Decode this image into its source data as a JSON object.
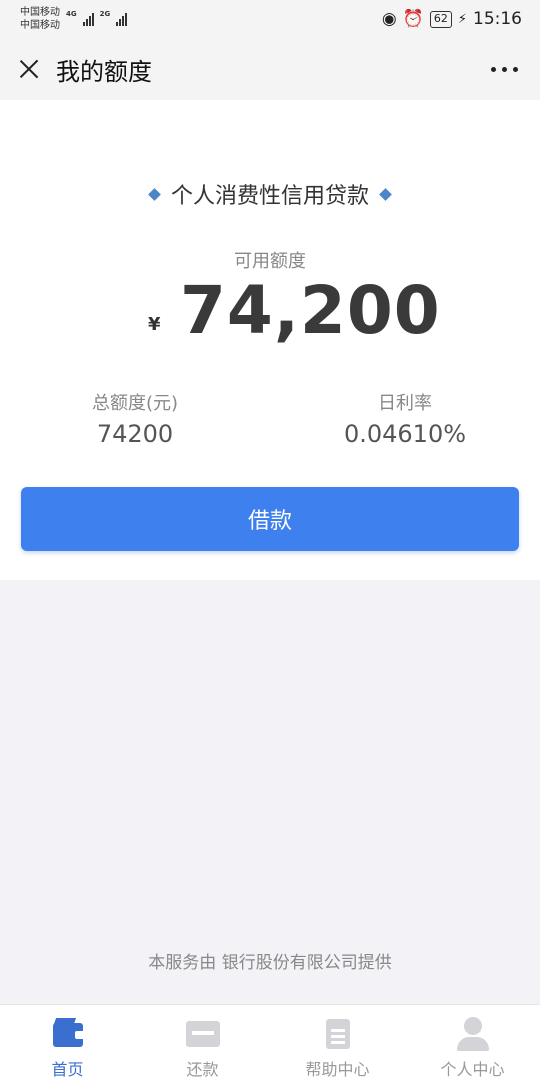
{
  "status_bar": {
    "carrier_1": "中国移动",
    "carrier_2": "中国移动",
    "network_1": "4G",
    "network_2": "2G",
    "battery": "62",
    "time": "15:16"
  },
  "nav": {
    "title": "我的额度"
  },
  "card": {
    "product_name": "个人消费性信用贷款",
    "available_label": "可用额度",
    "currency_symbol": "¥",
    "available_amount": "74,200",
    "total_label": "总额度(元)",
    "total_value": "74200",
    "rate_label": "日利率",
    "rate_value": "0.04610%",
    "borrow_button": "借款"
  },
  "footer": {
    "text": "本服务由  银行股份有限公司提供"
  },
  "tabs": [
    {
      "label": "首页",
      "icon": "wallet-icon",
      "active": true
    },
    {
      "label": "还款",
      "icon": "repay-icon",
      "active": false
    },
    {
      "label": "帮助中心",
      "icon": "document-icon",
      "active": false
    },
    {
      "label": "个人中心",
      "icon": "user-icon",
      "active": false
    }
  ],
  "colors": {
    "accent": "#3f80ef",
    "tab_active": "#3a6fd0",
    "diamond": "#4a86c8"
  }
}
